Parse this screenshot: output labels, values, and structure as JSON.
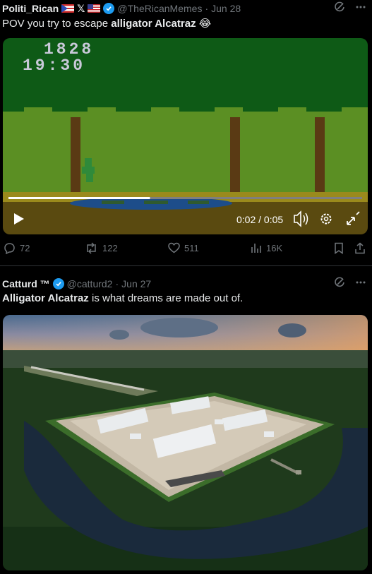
{
  "tweets": [
    {
      "name": "Politi_Rican",
      "x_mark": "𝕏",
      "handle": "@TheRicanMemes",
      "separator": "·",
      "date": "Jun 28",
      "text_before": "POV you try to escape ",
      "text_bold": "alligator Alcatraz",
      "text_after": " ",
      "emoji": "😂",
      "video": {
        "score": "1828",
        "clock": "19:30",
        "time": "0:02 / 0:05",
        "progress": 0.4
      },
      "stats": {
        "replies": "72",
        "reposts": "122",
        "likes": "511",
        "views": "16K"
      }
    },
    {
      "name": "Catturd ™",
      "handle": "@catturd2",
      "separator": "·",
      "date": "Jun 27",
      "text_bold": "Alligator Alcatraz",
      "text_after": " is what dreams are made out of."
    }
  ],
  "colors": {
    "accent": "#1d9bf0",
    "muted": "#71767b",
    "text": "#e7e9ea",
    "background": "#000000"
  },
  "icons": [
    "grok-icon",
    "more-icon",
    "verified-icon",
    "play-icon",
    "volume-icon",
    "settings-icon",
    "fullscreen-icon",
    "reply-icon",
    "repost-icon",
    "like-icon",
    "views-icon",
    "bookmark-icon",
    "share-icon"
  ]
}
